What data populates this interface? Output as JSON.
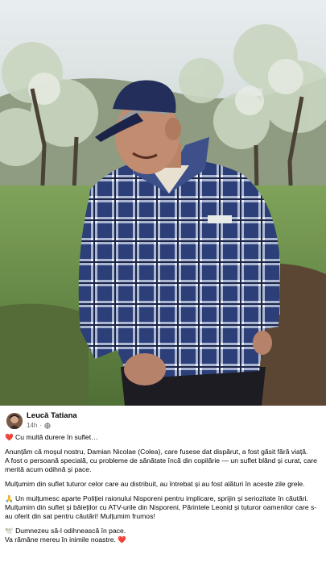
{
  "post": {
    "author": "Leucă Tatiana",
    "time": "14h",
    "privacy_icon": "globe-icon",
    "heart_emoji": "❤️",
    "pray_emoji": "🙏",
    "dove_emoji": "🕊️",
    "line1": "Cu multă durere în suflet…",
    "para1": "Anunțăm că moșul nostru, Damian Nicolae (Colea), care fusese dat dispărut, a fost găsit fără viață.",
    "para2": "A fost o persoană specială, cu probleme de sănătate încă din copilărie — un suflet blând și curat, care merită acum odihnă și pace.",
    "para3": "Mulțumim din suflet tuturor celor care au distribuit, au întrebat și au fost alături în aceste zile grele.",
    "para4": "Un mulțumesc aparte Poliției raionului Nisporeni pentru implicare, sprijin și seriozitate în căutări.",
    "para5": "Mulțumim din suflet și băieților cu ATV-urile din Nisporeni, Părintele Leonid și tuturor oamenilor care s-au oferit din sat pentru căutări! Mulțumim frumos!",
    "para6": "Dumnezeu să-l odihnească în pace.",
    "para7": "Va rămâne mereu în inimile noastre."
  }
}
